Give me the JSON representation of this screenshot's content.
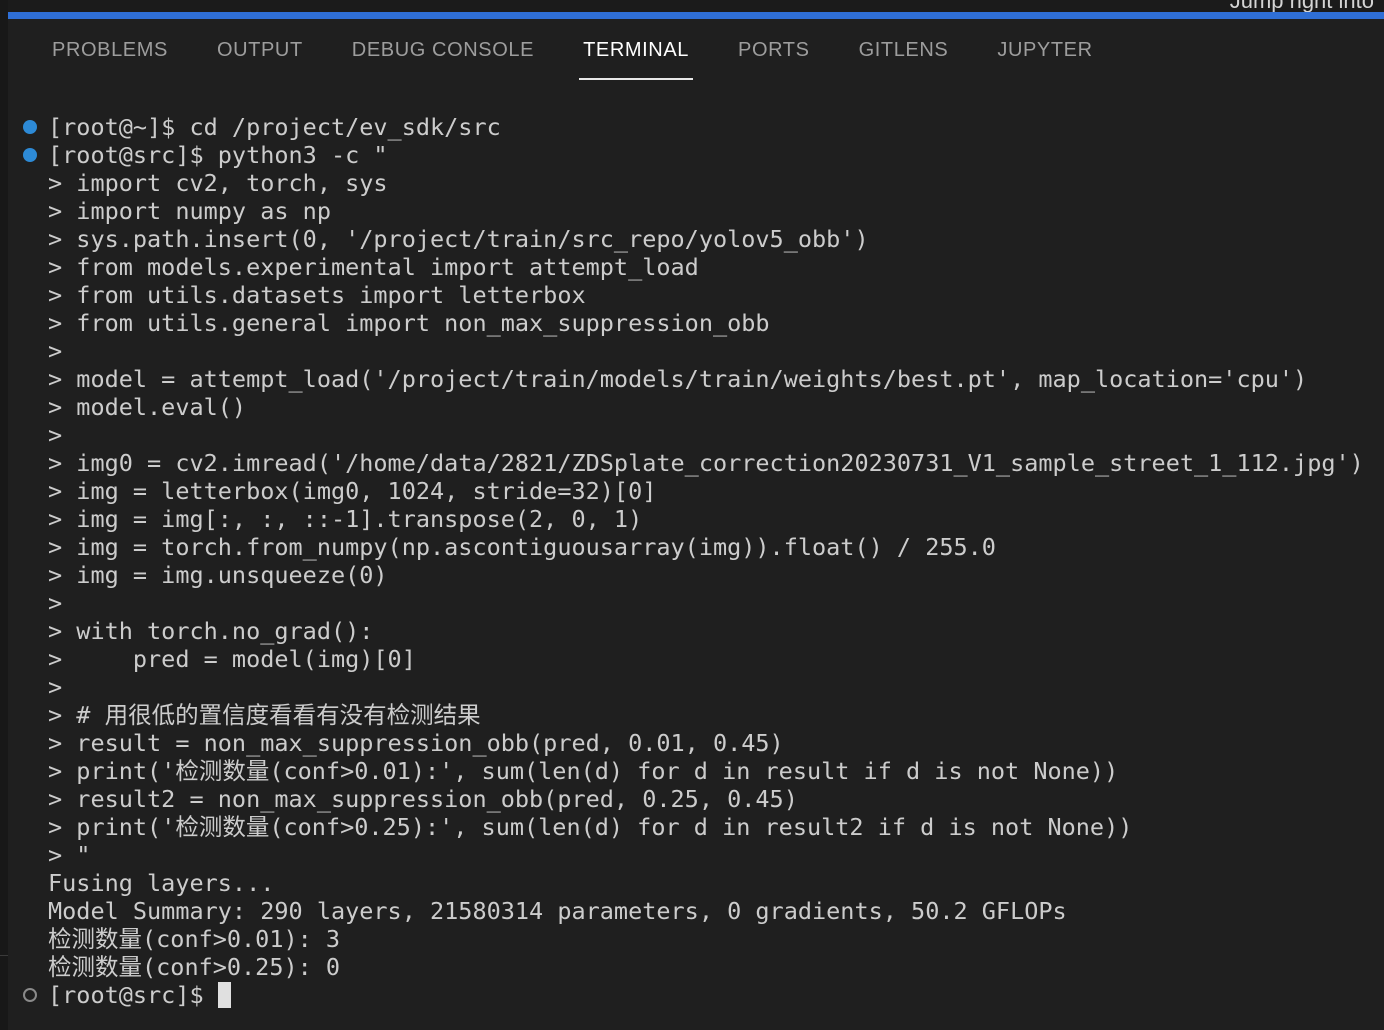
{
  "window": {
    "peek_text": "Jump right into"
  },
  "panel": {
    "tabs": [
      {
        "label": "PROBLEMS",
        "active": false
      },
      {
        "label": "OUTPUT",
        "active": false
      },
      {
        "label": "DEBUG CONSOLE",
        "active": false
      },
      {
        "label": "TERMINAL",
        "active": true
      },
      {
        "label": "PORTS",
        "active": false
      },
      {
        "label": "GITLENS",
        "active": false
      },
      {
        "label": "JUPYTER",
        "active": false
      }
    ]
  },
  "terminal": {
    "lines": [
      {
        "text": "[root@~]$ cd /project/ev_sdk/src",
        "decoration": "done"
      },
      {
        "text": "[root@src]$ python3 -c \"",
        "decoration": "done"
      },
      {
        "text": "> import cv2, torch, sys"
      },
      {
        "text": "> import numpy as np"
      },
      {
        "text": "> sys.path.insert(0, '/project/train/src_repo/yolov5_obb')"
      },
      {
        "text": "> from models.experimental import attempt_load"
      },
      {
        "text": "> from utils.datasets import letterbox"
      },
      {
        "text": "> from utils.general import non_max_suppression_obb"
      },
      {
        "text": ">"
      },
      {
        "text": "> model = attempt_load('/project/train/models/train/weights/best.pt', map_location='cpu')"
      },
      {
        "text": "> model.eval()"
      },
      {
        "text": ">"
      },
      {
        "text": "> img0 = cv2.imread('/home/data/2821/ZDSplate_correction20230731_V1_sample_street_1_112.jpg')"
      },
      {
        "text": "> img = letterbox(img0, 1024, stride=32)[0]"
      },
      {
        "text": "> img = img[:, :, ::-1].transpose(2, 0, 1)"
      },
      {
        "text": "> img = torch.from_numpy(np.ascontiguousarray(img)).float() / 255.0"
      },
      {
        "text": "> img = img.unsqueeze(0)"
      },
      {
        "text": ">"
      },
      {
        "text": "> with torch.no_grad():"
      },
      {
        "text": ">     pred = model(img)[0]"
      },
      {
        "text": ">"
      },
      {
        "text": "> # 用很低的置信度看看有没有检测结果"
      },
      {
        "text": "> result = non_max_suppression_obb(pred, 0.01, 0.45)"
      },
      {
        "text": "> print('检测数量(conf>0.01):', sum(len(d) for d in result if d is not None))"
      },
      {
        "text": "> result2 = non_max_suppression_obb(pred, 0.25, 0.45)"
      },
      {
        "text": "> print('检测数量(conf>0.25):', sum(len(d) for d in result2 if d is not None))"
      },
      {
        "text": "> \""
      },
      {
        "text": "Fusing layers..."
      },
      {
        "text": "Model Summary: 290 layers, 21580314 parameters, 0 gradients, 50.2 GFLOPs"
      },
      {
        "text": "检测数量(conf>0.01): 3"
      },
      {
        "text": "检测数量(conf>0.25): 0"
      }
    ],
    "prompt_line": {
      "text": "[root@src]$ ",
      "decoration": "empty"
    },
    "colors": {
      "background": "#1f1f1f",
      "text": "#cccccc",
      "decoration_done": "#2d8ad6",
      "accent": "#2f6fd6"
    }
  }
}
